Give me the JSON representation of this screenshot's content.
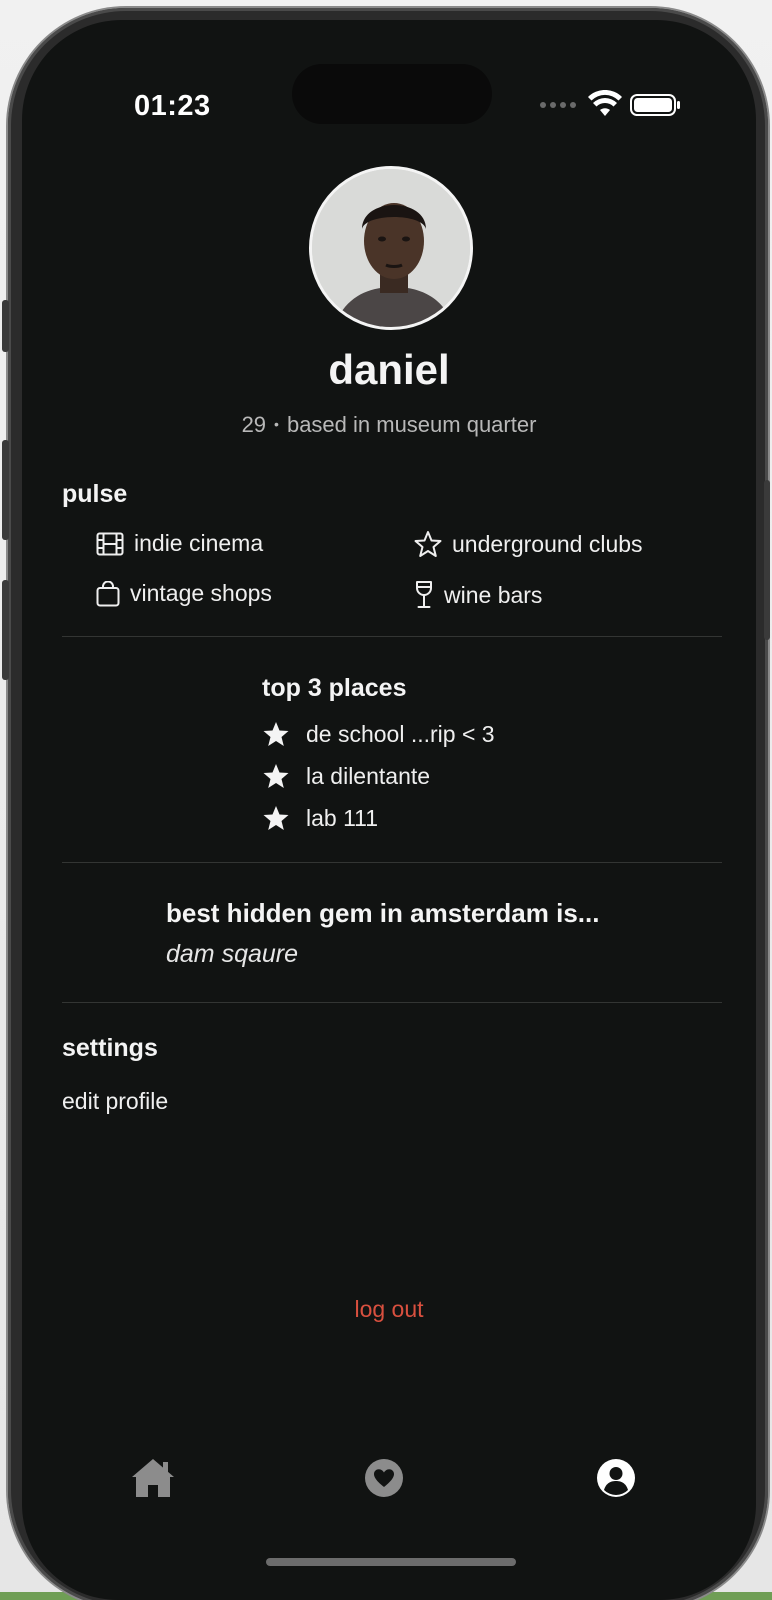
{
  "status_bar": {
    "time": "01:23",
    "icons": [
      "signal-dots-icon",
      "wifi-icon",
      "battery-icon"
    ]
  },
  "profile": {
    "name": "daniel",
    "age": "29",
    "separator": "•",
    "location": "based in museum quarter"
  },
  "pulse": {
    "title": "pulse",
    "items": [
      {
        "label": "indie cinema",
        "icon": "film-icon"
      },
      {
        "label": "underground clubs",
        "icon": "star-outline-icon"
      },
      {
        "label": "vintage shops",
        "icon": "shopping-bag-icon"
      },
      {
        "label": "wine bars",
        "icon": "wine-glass-icon"
      }
    ]
  },
  "top_places": {
    "title": "top 3 places",
    "items": [
      {
        "label": "de school ...rip < 3",
        "icon": "star-filled-icon"
      },
      {
        "label": "la dilentante",
        "icon": "star-filled-icon"
      },
      {
        "label": "lab 111",
        "icon": "star-filled-icon"
      }
    ]
  },
  "hidden_gem": {
    "question": "best hidden gem in amsterdam is...",
    "answer": "dam sqaure"
  },
  "settings": {
    "title": "settings",
    "edit_profile": "edit profile",
    "logout": "log out"
  },
  "tab_bar": {
    "tabs": [
      {
        "icon": "home-icon",
        "active": false
      },
      {
        "icon": "heart-icon",
        "active": false
      },
      {
        "icon": "profile-icon",
        "active": true
      }
    ]
  },
  "colors": {
    "background": "#111312",
    "text": "#f2f2f2",
    "muted": "#b8b8b8",
    "logout": "#d9503f",
    "tab_inactive": "#8c8c8c",
    "tab_active": "#ffffff"
  }
}
